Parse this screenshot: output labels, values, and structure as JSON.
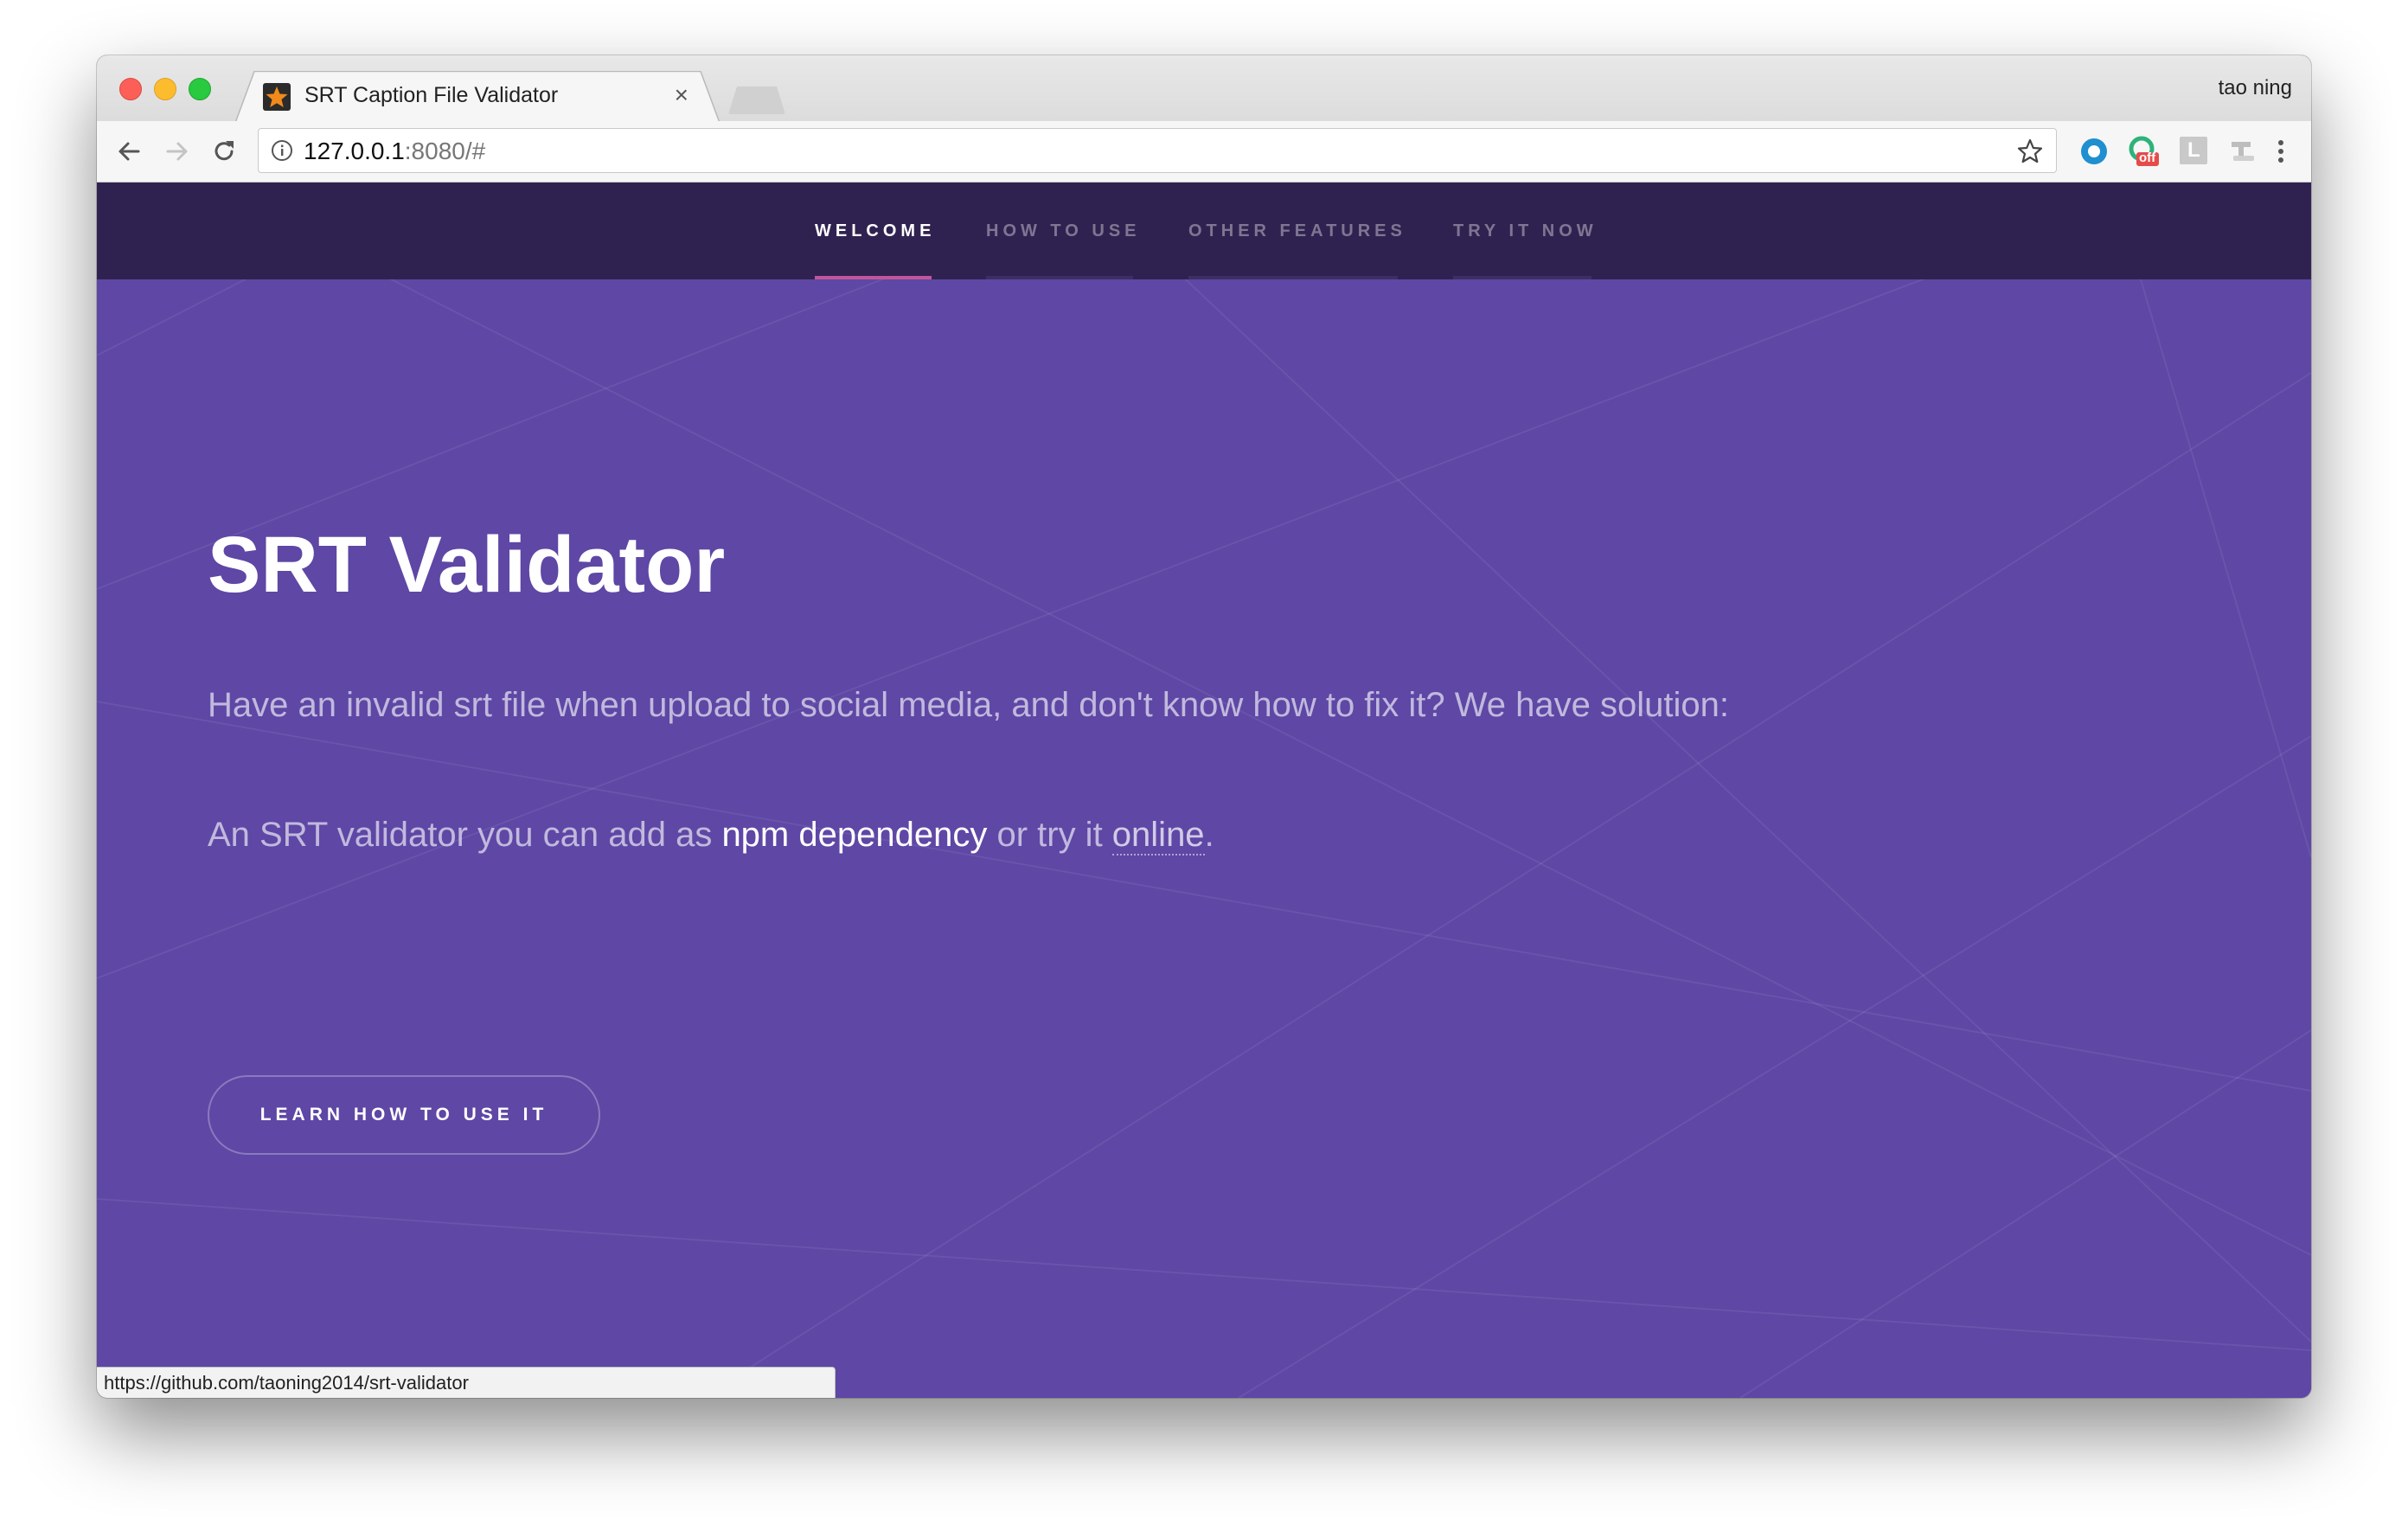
{
  "browser": {
    "tab_title": "SRT Caption File Validator",
    "tab_close": "×",
    "profile_name": "tao ning",
    "url_host": "127.0.0.1",
    "url_rest": ":8080/#",
    "status_url": "https://github.com/taoning2014/srt-validator",
    "extensions": [
      "circle-extension-icon",
      "off-extension-icon",
      "l-extension-icon",
      "translate-extension-icon"
    ],
    "extension_badges": {
      "off": "off",
      "l": "L"
    },
    "colors": {
      "tab_bar": "#dcdcdc",
      "toolbar": "#f6f6f6"
    }
  },
  "site": {
    "nav": {
      "items": [
        {
          "label": "WELCOME",
          "active": true
        },
        {
          "label": "HOW TO USE",
          "active": false
        },
        {
          "label": "OTHER FEATURES",
          "active": false
        },
        {
          "label": "TRY IT NOW",
          "active": false
        }
      ]
    },
    "hero": {
      "title": "SRT Validator",
      "lead": "Have an invalid srt file when upload to social media, and don't know how to fix it? We have solution:",
      "line2_pre": "An SRT validator you can add as ",
      "line2_link1": "npm dependency",
      "line2_mid": " or try it ",
      "line2_link2": "online",
      "line2_post": ".",
      "cta_label": "LEARN HOW TO USE IT"
    },
    "colors": {
      "background": "#5e47a5",
      "nav_background": "#302250",
      "nav_active_underline": "#c0569a",
      "nav_inactive_underline": "#3d2f63"
    }
  }
}
